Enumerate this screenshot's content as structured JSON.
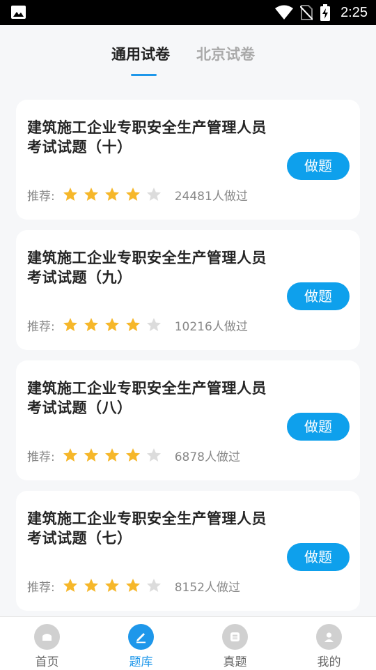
{
  "status_bar": {
    "time": "2:25"
  },
  "tabs": [
    {
      "label": "通用试卷",
      "active": true
    },
    {
      "label": "北京试卷",
      "active": false
    }
  ],
  "exams": [
    {
      "title": "建筑施工企业专职安全生产管理人员考试试题（十）",
      "rec_label": "推荐:",
      "stars_filled": 4,
      "stars_total": 5,
      "count": "24481人做过",
      "button": "做题"
    },
    {
      "title": "建筑施工企业专职安全生产管理人员考试试题（九）",
      "rec_label": "推荐:",
      "stars_filled": 4,
      "stars_total": 5,
      "count": "10216人做过",
      "button": "做题"
    },
    {
      "title": "建筑施工企业专职安全生产管理人员考试试题（八）",
      "rec_label": "推荐:",
      "stars_filled": 4,
      "stars_total": 5,
      "count": "6878人做过",
      "button": "做题"
    },
    {
      "title": "建筑施工企业专职安全生产管理人员考试试题（七）",
      "rec_label": "推荐:",
      "stars_filled": 4,
      "stars_total": 5,
      "count": "8152人做过",
      "button": "做题"
    }
  ],
  "bottom_nav": [
    {
      "label": "首页",
      "icon": "home-icon",
      "active": false
    },
    {
      "label": "题库",
      "icon": "edit-icon",
      "active": true
    },
    {
      "label": "真题",
      "icon": "list-icon",
      "active": false
    },
    {
      "label": "我的",
      "icon": "user-icon",
      "active": false
    }
  ],
  "colors": {
    "accent": "#1e97ea",
    "button": "#0ea0ec",
    "star_filled": "#f6b72a",
    "star_empty": "#dcdcdc"
  }
}
